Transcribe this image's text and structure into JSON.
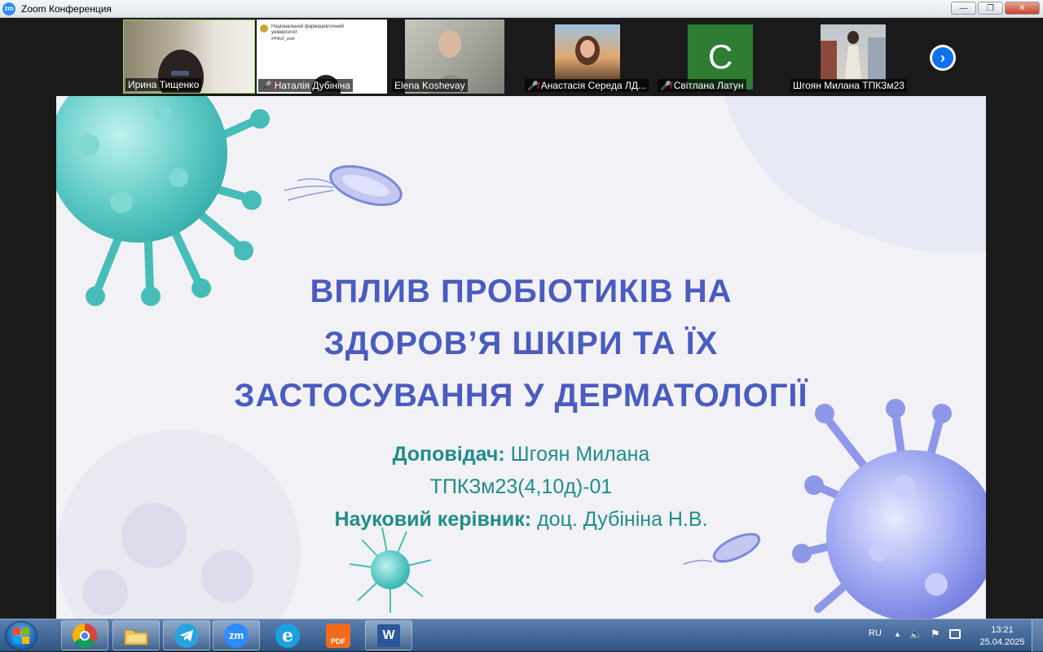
{
  "window": {
    "title": "Zoom Конференция",
    "logo_text": "zm",
    "minimize_glyph": "—",
    "restore_glyph": "❐",
    "close_glyph": "✕"
  },
  "participants": [
    {
      "name": "Ирина Тищенко",
      "muted": false,
      "active": true
    },
    {
      "name": "Наталія Дубініна",
      "muted": true,
      "active": false,
      "screen_text": "Національний фармацевтичний університет",
      "screen_tag": "#НФаУ_start"
    },
    {
      "name": "Elena Koshevay",
      "muted": false,
      "active": false
    },
    {
      "name": "Анастасія Середа ЛД...",
      "muted": true,
      "active": false
    },
    {
      "name": "Світлана Латун",
      "muted": true,
      "active": false,
      "avatar_letter": "С",
      "avatar_color": "#2e7d32"
    },
    {
      "name": "Шгоян Милана ТПКЗм23",
      "muted": false,
      "active": false
    }
  ],
  "next_page_glyph": "›",
  "slide": {
    "title_lines": [
      "ВПЛИВ ПРОБІОТИКІВ НА",
      "ЗДОРОВ’Я ШКІРИ ТА ЇХ",
      "ЗАСТОСУВАННЯ У ДЕРМАТОЛОГІЇ"
    ],
    "speaker_label": "Доповідач:",
    "speaker_name": "Шгоян Милана",
    "group": "ТПКЗм23(4,10д)-01",
    "advisor_label": "Науковий керівник:",
    "advisor_name": "доц. Дубініна Н.В.",
    "title_color": "#4a5cc0",
    "body_color": "#1e8d8a"
  },
  "taskbar": {
    "apps": [
      {
        "name": "chrome-icon"
      },
      {
        "name": "folder-icon"
      },
      {
        "name": "telegram-icon"
      },
      {
        "name": "zoom-icon",
        "label": "zm"
      },
      {
        "name": "ie-icon",
        "label": "e"
      },
      {
        "name": "pdf-icon",
        "label": "PDF"
      },
      {
        "name": "word-icon",
        "label": "W"
      }
    ],
    "language": "RU",
    "time": "13:21",
    "date": "25.04.2025"
  }
}
